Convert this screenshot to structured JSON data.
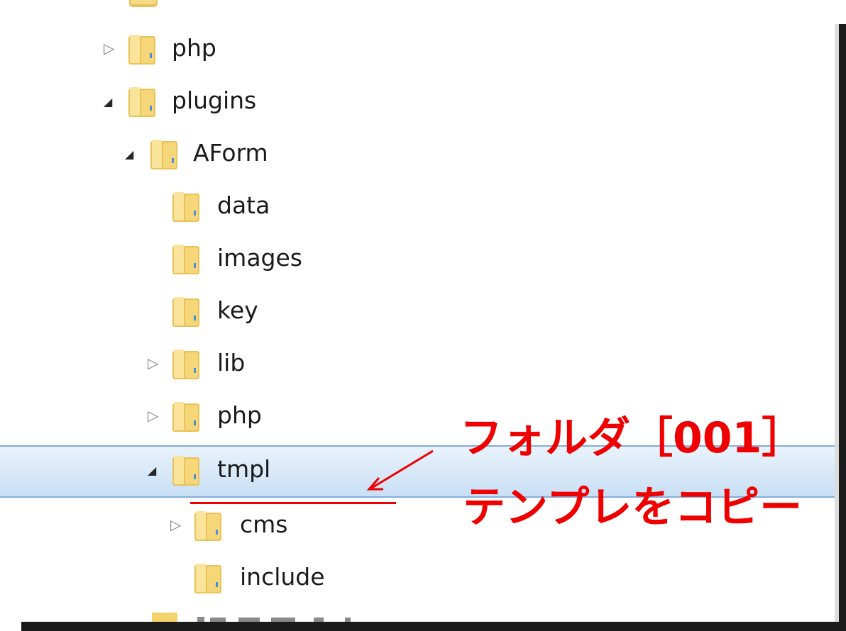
{
  "tree": {
    "items": [
      {
        "label": "php",
        "state": "collapsed"
      },
      {
        "label": "plugins",
        "state": "expanded"
      },
      {
        "label": "AForm",
        "state": "expanded"
      },
      {
        "label": "data",
        "state": "none"
      },
      {
        "label": "images",
        "state": "none"
      },
      {
        "label": "key",
        "state": "none"
      },
      {
        "label": "lib",
        "state": "collapsed"
      },
      {
        "label": "php",
        "state": "collapsed"
      },
      {
        "label": "tmpl",
        "state": "expanded",
        "selected": true
      },
      {
        "label": "cms",
        "state": "collapsed"
      },
      {
        "label": "include",
        "state": "none"
      }
    ]
  },
  "annotation": {
    "line1": "フォルダ［001］",
    "line2": "テンプレをコピー",
    "color": "#ee0000"
  },
  "colors": {
    "folder_main": "#f3d26b",
    "selection_border": "#84acdd"
  }
}
